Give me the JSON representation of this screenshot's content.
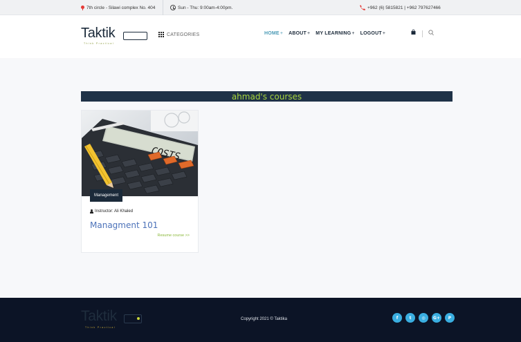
{
  "topbar": {
    "address": "7th circle - Silawi complex No. 404",
    "hours": "Sun - Thu: 9:00am-4:00pm.",
    "phone": "+962 (6) 5815821 | +962 797627466"
  },
  "header": {
    "logo_word": "Taktik",
    "logo_tag": "Think Practical",
    "categories_label": "CATEGORIES",
    "nav": [
      {
        "label": "HOME"
      },
      {
        "label": "ABOUT"
      },
      {
        "label": "MY LEARNING"
      },
      {
        "label": "LOGOUT"
      }
    ],
    "nav_suffix": "+"
  },
  "main": {
    "title": "ahmad's courses",
    "courses": [
      {
        "category": "Management",
        "instructor": "Instructor: Ali Khaled",
        "title": "Managment 101",
        "resume_label": "Resume course >>",
        "thumb_text": "COSTS"
      }
    ]
  },
  "footer": {
    "logo_word": "Taktik",
    "logo_tag": "Think Practical",
    "copyright": "Copyright 2021 © Taktika",
    "socials": [
      {
        "icon": "facebook-icon",
        "glyph": "f"
      },
      {
        "icon": "twitter-icon",
        "glyph": "t"
      },
      {
        "icon": "instagram-icon",
        "glyph": "◎"
      },
      {
        "icon": "google-plus-icon",
        "glyph": "G+"
      },
      {
        "icon": "pinterest-icon",
        "glyph": "P"
      }
    ]
  },
  "colors": {
    "accent": "#4c9bb6",
    "banner_bg": "#1f3247",
    "banner_text": "#a8d53c",
    "footer_bg": "#0c1426",
    "social": "#3aaee0"
  }
}
